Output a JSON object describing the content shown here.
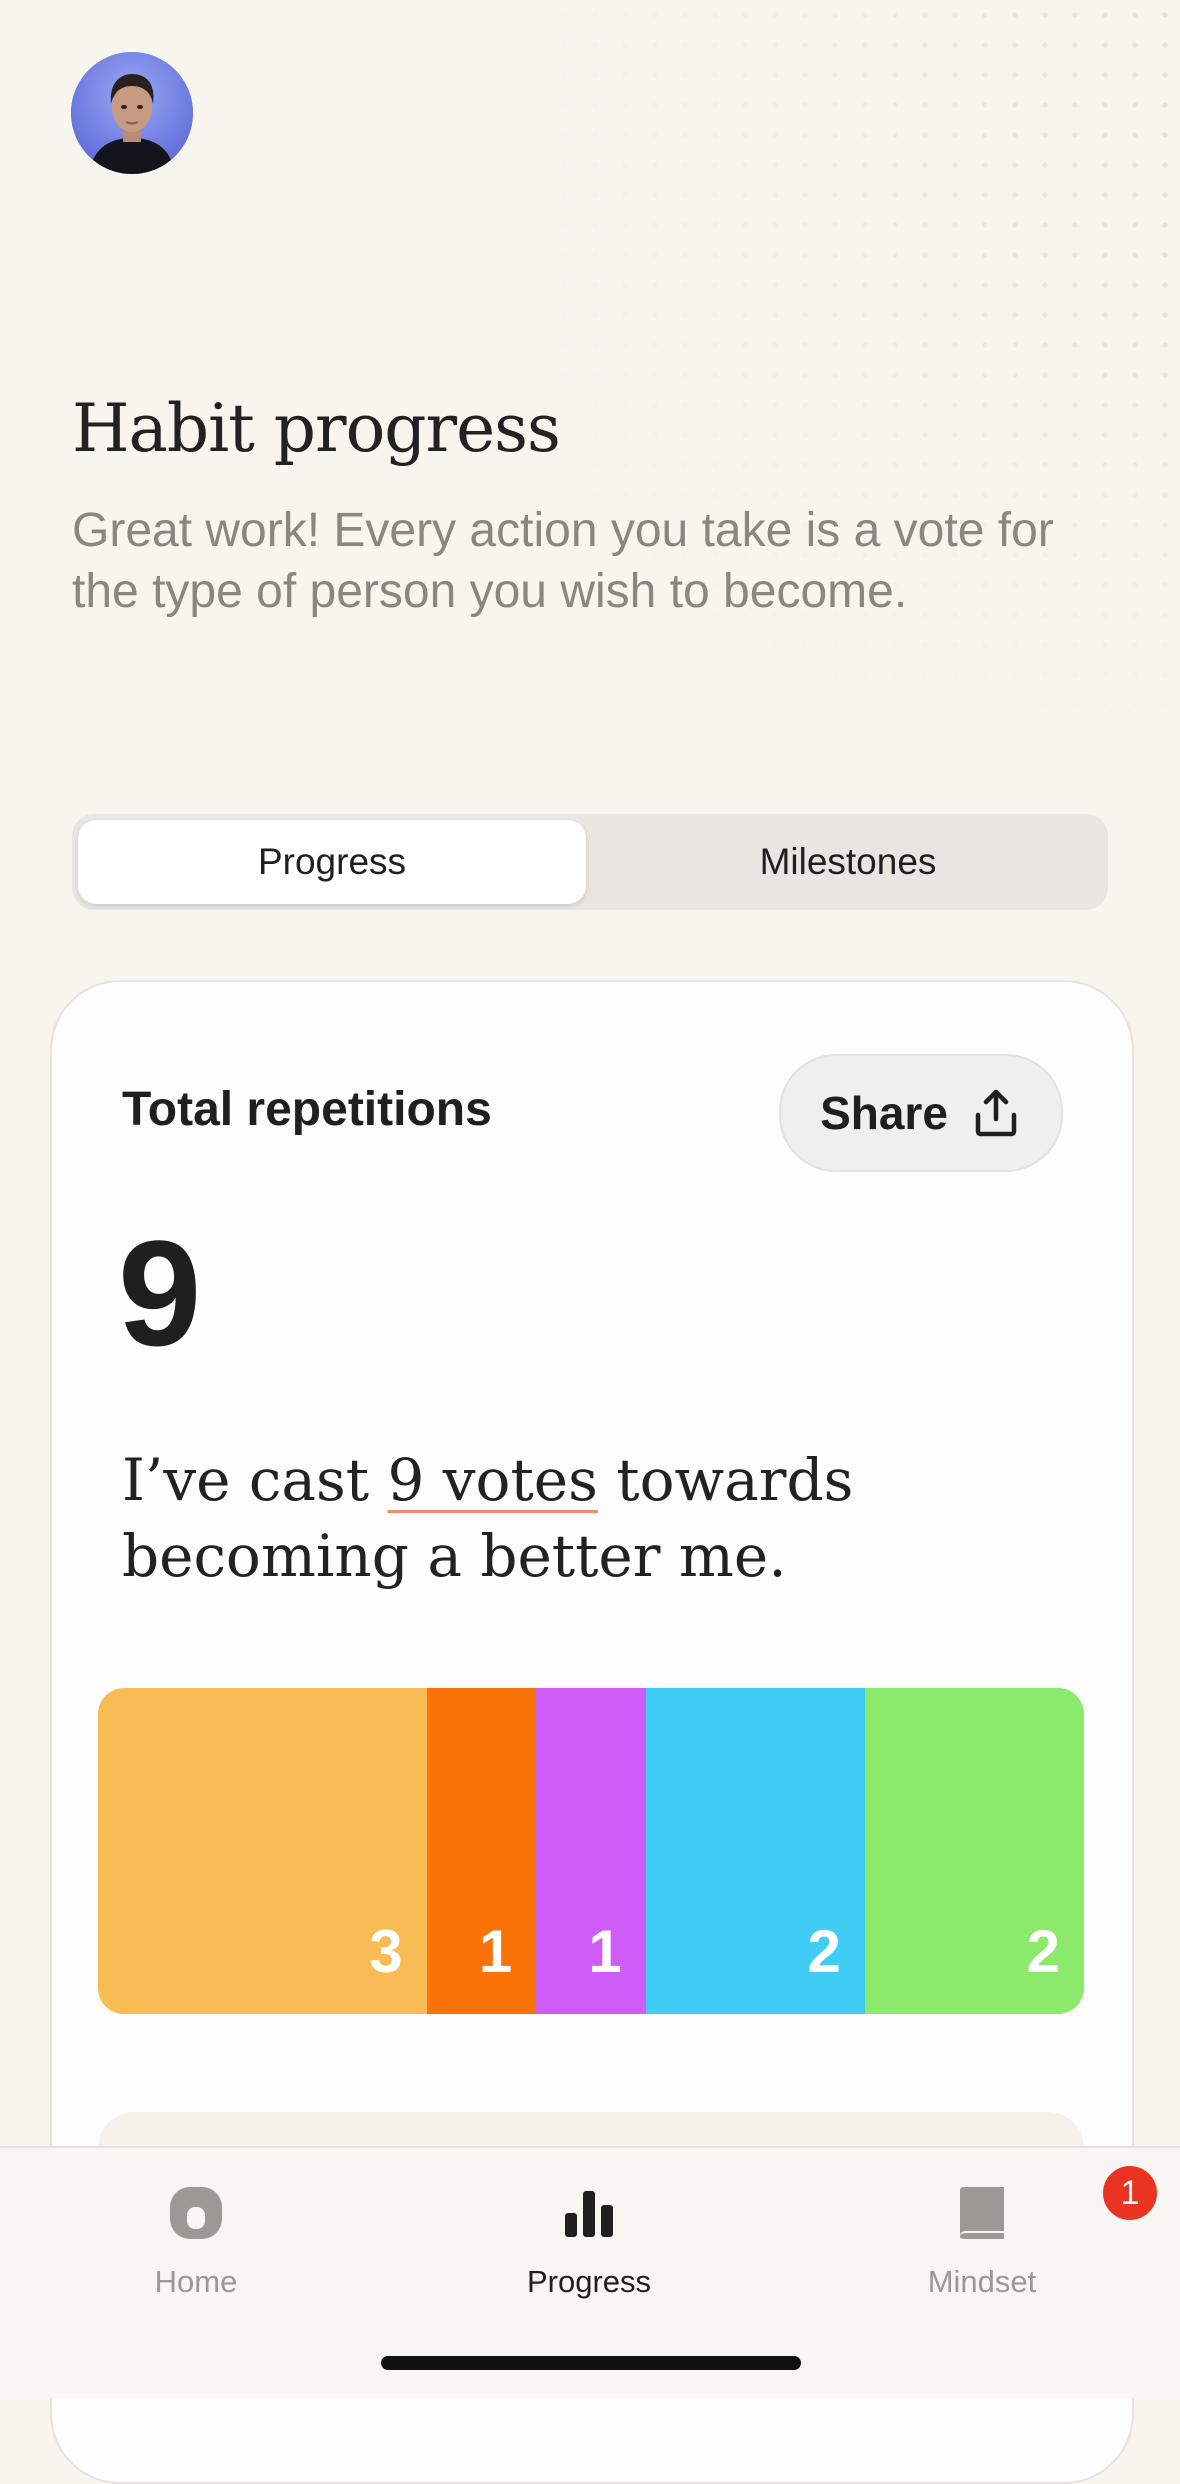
{
  "header": {
    "title": "Habit progress",
    "subtitle": "Great work! Every action you take is a vote for the type of person you wish to become."
  },
  "segmented_control": {
    "tabs": [
      {
        "label": "Progress",
        "selected": true
      },
      {
        "label": "Milestones",
        "selected": false
      }
    ]
  },
  "card": {
    "title": "Total repetitions",
    "share_label": "Share",
    "share_icon": "share-upload-icon",
    "total": "9",
    "statement": {
      "prefix": "I’ve cast ",
      "highlight": "9 votes",
      "suffix": " towards becoming a better me."
    }
  },
  "chart_data": {
    "type": "bar",
    "orientation": "horizontal-stacked",
    "segments": [
      {
        "value": 3,
        "color": "#f9bc55"
      },
      {
        "value": 1,
        "color": "#fb7306"
      },
      {
        "value": 1,
        "color": "#d05cf7"
      },
      {
        "value": 2,
        "color": "#40ccf5"
      },
      {
        "value": 2,
        "color": "#8be96c"
      }
    ],
    "labels": [
      "3",
      "1",
      "1",
      "2",
      "2"
    ],
    "total": 9
  },
  "tabbar": {
    "items": [
      {
        "label": "Home",
        "icon": "home-icon",
        "active": false
      },
      {
        "label": "Progress",
        "icon": "bar-chart-icon",
        "active": true
      },
      {
        "label": "Mindset",
        "icon": "book-icon",
        "active": false,
        "badge": "1"
      }
    ]
  },
  "colors": {
    "background": "#f8f5ef",
    "badge": "#ea3323",
    "underline": "#f08a6a"
  }
}
